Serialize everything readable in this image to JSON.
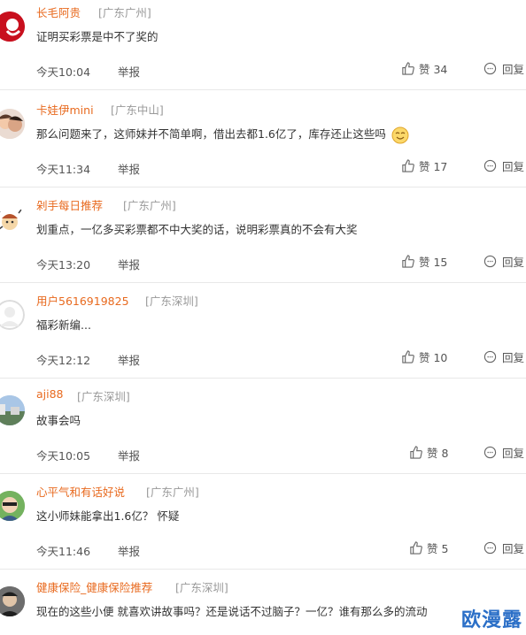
{
  "comments": [
    {
      "username": "长毛阿贵",
      "location": "[广东广州]",
      "text": "证明买彩票是中不了奖的",
      "time": "今天10:04",
      "report": "举报",
      "likes": "赞 34",
      "reply": "回复"
    },
    {
      "username": "卡娃伊mini",
      "location": "[广东中山]",
      "text": "那么问题来了，这师妹并不简单啊，借出去都1.6亿了，库存还止这些吗",
      "time": "今天11:34",
      "report": "举报",
      "likes": "赞 17",
      "reply": "回复"
    },
    {
      "username": "剁手每日推荐",
      "location": "[广东广州]",
      "text": "划重点，一亿多买彩票都不中大奖的话，说明彩票真的不会有大奖",
      "time": "今天13:20",
      "report": "举报",
      "likes": "赞 15",
      "reply": "回复"
    },
    {
      "username": "用户5616919825",
      "location": "[广东深圳]",
      "text": "福彩新编...",
      "time": "今天12:12",
      "report": "举报",
      "likes": "赞 10",
      "reply": "回复"
    },
    {
      "username": "aji88",
      "location": "[广东深圳]",
      "text": "故事会吗",
      "time": "今天10:05",
      "report": "举报",
      "likes": "赞 8",
      "reply": "回复"
    },
    {
      "username": "心平气和有话好说",
      "location": "[广东广州]",
      "text": "这小师妹能拿出1.6亿？ 怀疑",
      "time": "今天11:46",
      "report": "举报",
      "likes": "赞 5",
      "reply": "回复"
    },
    {
      "username": "健康保险_健康保险推荐",
      "location": "[广东深圳]",
      "text": "现在的这些小便 就喜欢讲故事吗？还是说话不过脑子？一亿？谁有那么多的流动",
      "time": "",
      "report": "",
      "likes": "",
      "reply": ""
    }
  ],
  "watermark": "欧漫露",
  "colors": {
    "username": "#e86a1f",
    "location": "#999999",
    "divider": "#e8e8e8",
    "watermark": "#2b6fc7"
  },
  "icons": {
    "like": "thumbs-up-icon",
    "reply": "speech-bubble-icon",
    "emoji": "smiling-face-emoji"
  }
}
